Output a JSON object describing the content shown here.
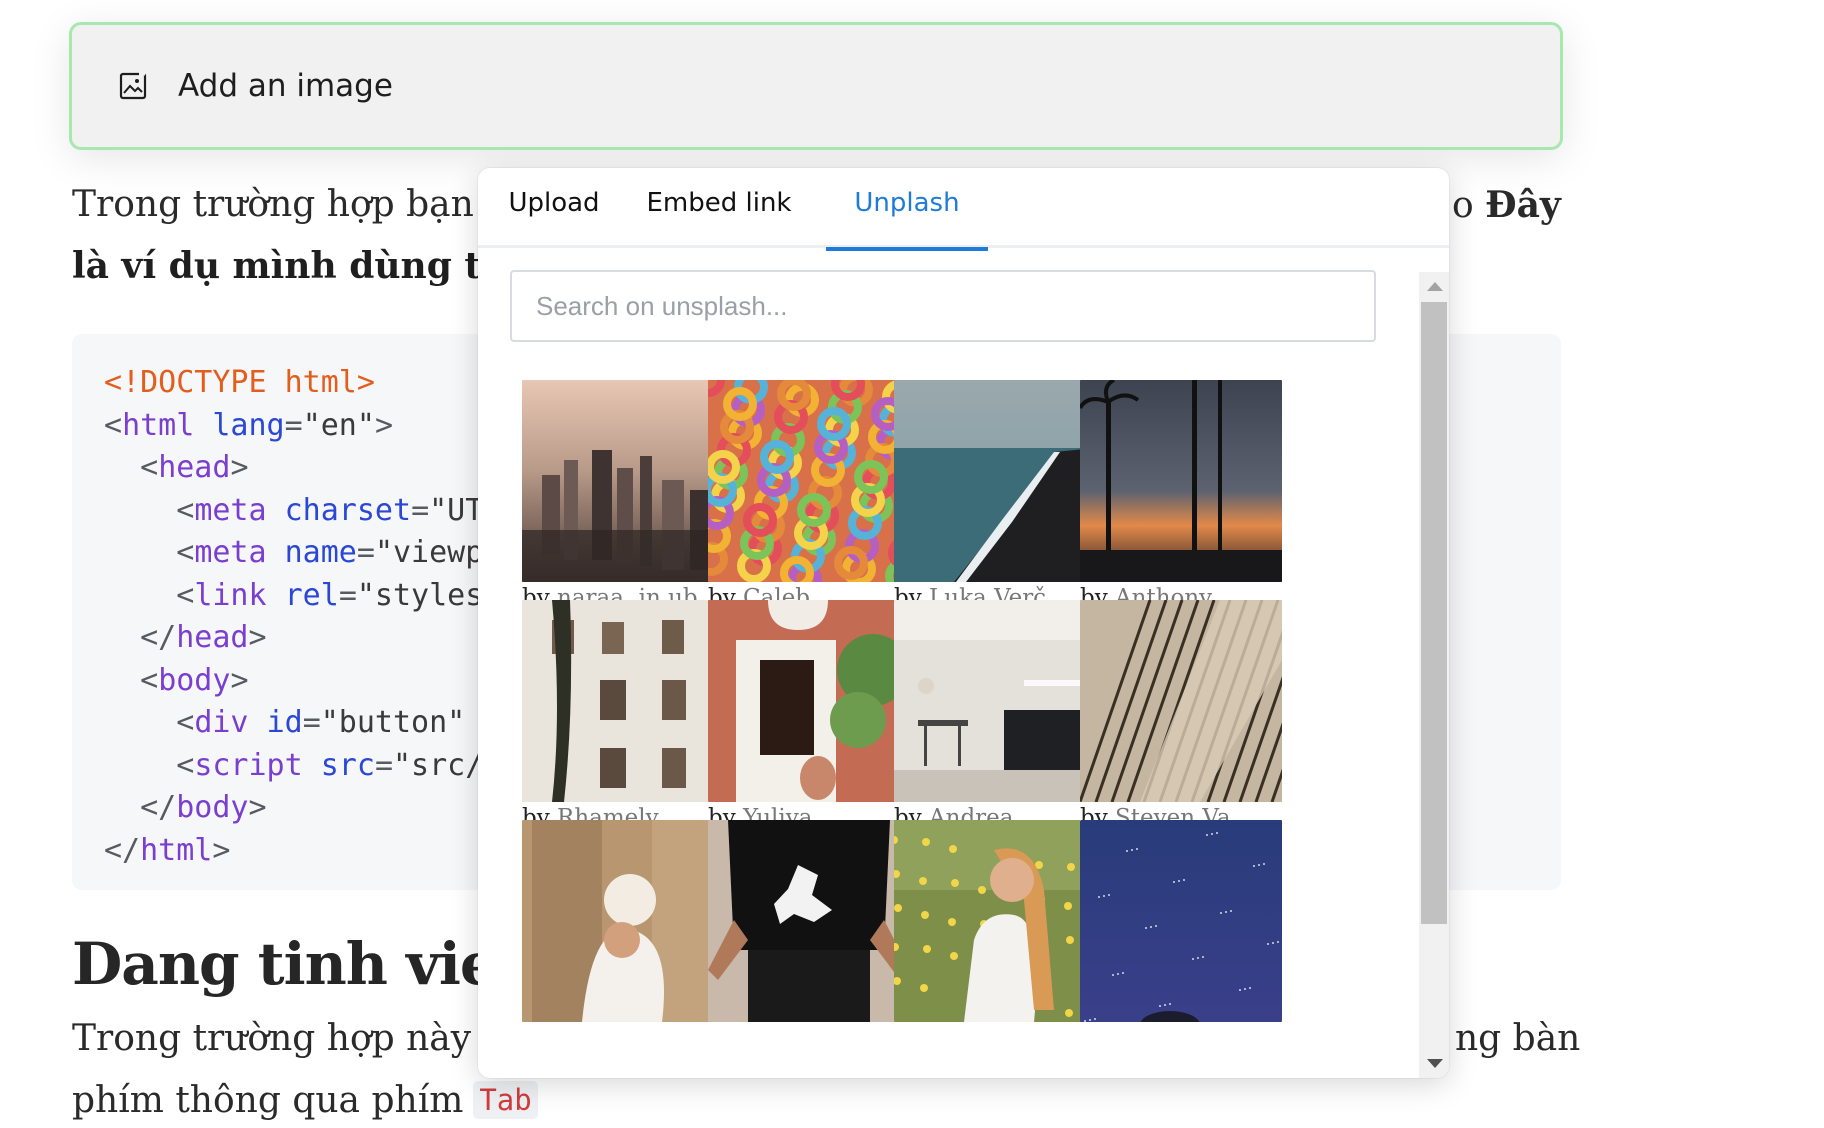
{
  "image_block": {
    "label": "Add an image",
    "icon": "image-add-icon"
  },
  "document": {
    "para1_line1": "Trong trường hợp bạn p",
    "para1_line1_right": "o ",
    "para1_line1_right_bold": "Đây",
    "para1_line2": "là ví dụ mình dùng thẻ",
    "code_lines": [
      "<!DOCTYPE html>",
      "<html lang=\"en\">",
      "  <head>",
      "    <meta charset=\"UT",
      "    <meta name=\"viewp",
      "    <link rel=\"styles",
      "  </head>",
      "  <body>",
      "    <div id=\"button\"",
      "    <script src=\"src/",
      "  </body>",
      "</html>"
    ],
    "heading": "Dang tinh viet a",
    "para2_line1": "Trong trường hợp này m",
    "para2_line1_right": "ng bàn",
    "para2_line2": "phím thông qua phím",
    "para2_kbd": "Tab"
  },
  "picker": {
    "tabs": [
      {
        "label": "Upload",
        "active": false
      },
      {
        "label": "Embed link",
        "active": false
      },
      {
        "label": "Unplash",
        "active": true
      }
    ],
    "search": {
      "placeholder": "Search on unsplash...",
      "value": ""
    },
    "photos": [
      {
        "by": "by",
        "author": "naraa .in.ub",
        "subject": "city skyline at sunset"
      },
      {
        "by": "by",
        "author": "Caleb...",
        "subject": "colorful cereal rings"
      },
      {
        "by": "by",
        "author": "Luka Verč",
        "subject": "black sand beach aerial"
      },
      {
        "by": "by",
        "author": "Anthony...",
        "subject": "palm trees silhouette at dusk"
      },
      {
        "by": "by",
        "author": "Rhamely",
        "subject": "apartment building facade"
      },
      {
        "by": "by",
        "author": "Yuliya...",
        "subject": "arched doorway with plants"
      },
      {
        "by": "by",
        "author": "Andrea...",
        "subject": "modern kitchen interior"
      },
      {
        "by": "by",
        "author": "Steven Va...",
        "subject": "balcony railings abstract"
      },
      {
        "by": "",
        "author": "",
        "subject": "woman with baby at wooden door"
      },
      {
        "by": "",
        "author": "",
        "subject": "person in black graphic t-shirt"
      },
      {
        "by": "",
        "author": "",
        "subject": "woman in wildflower field"
      },
      {
        "by": "",
        "author": "",
        "subject": "starry night sky"
      }
    ]
  },
  "colors": {
    "accent": "#1f7bd8",
    "image_block_border": "#a7e8ae",
    "code_doctype": "#e35d1c",
    "code_tag": "#7a3fd0",
    "code_attr": "#2b47d6"
  }
}
